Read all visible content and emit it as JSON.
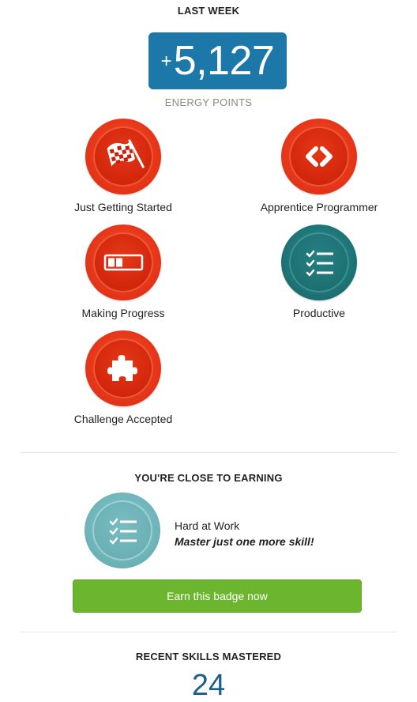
{
  "last_week": {
    "title": "LAST WEEK",
    "points_sign": "+",
    "points_value": "5,127",
    "points_label": "ENERGY POINTS"
  },
  "badges": [
    {
      "label": "Just Getting Started",
      "icon": "checkered-flag-icon",
      "color": "#e8371b"
    },
    {
      "label": "Apprentice Programmer",
      "icon": "code-brackets-icon",
      "color": "#e8371b"
    },
    {
      "label": "Making Progress",
      "icon": "progress-bar-icon",
      "color": "#e8371b"
    },
    {
      "label": "Productive",
      "icon": "checklist-icon",
      "color": "#1e7476"
    },
    {
      "label": "Challenge Accepted",
      "icon": "puzzle-piece-icon",
      "color": "#e8371b"
    }
  ],
  "close_to_earning": {
    "title": "YOU'RE CLOSE TO EARNING",
    "badge_name": "Hard at Work",
    "badge_hint": "Master just one more skill!",
    "icon": "checklist-icon",
    "button_label": "Earn this badge now",
    "button_color": "#6cb62f"
  },
  "recent_skills": {
    "title": "RECENT SKILLS MASTERED",
    "count": "24",
    "count_color": "#1c5e8c"
  }
}
